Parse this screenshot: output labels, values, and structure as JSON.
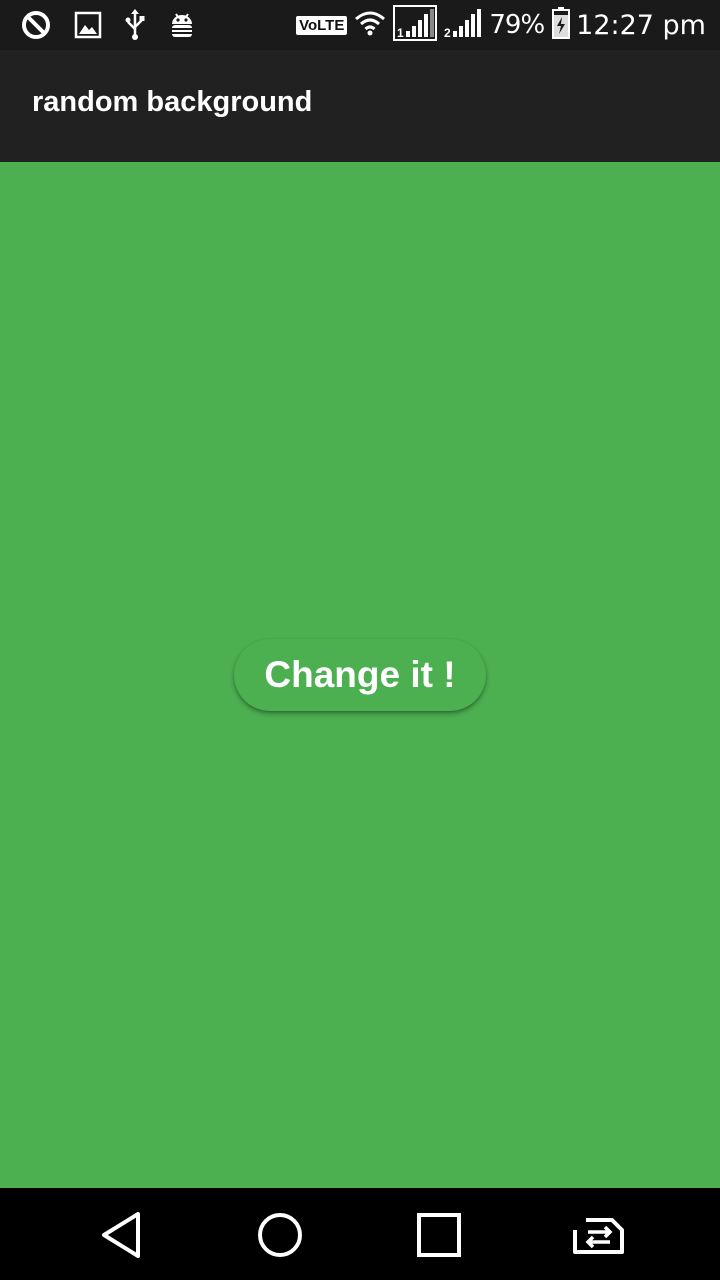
{
  "status_bar": {
    "left_icons": [
      "do-not-disturb-icon",
      "image-icon",
      "usb-icon",
      "android-debug-icon"
    ],
    "volte_label": "VoLTE",
    "battery_percent": "79%",
    "time": "12:27 pm"
  },
  "app_bar": {
    "title": "random background"
  },
  "main": {
    "background_color": "#4caf50",
    "button_label": "Change it !"
  },
  "nav_bar": {
    "buttons": [
      "back-icon",
      "home-icon",
      "recents-icon",
      "switch-sim-icon"
    ]
  }
}
